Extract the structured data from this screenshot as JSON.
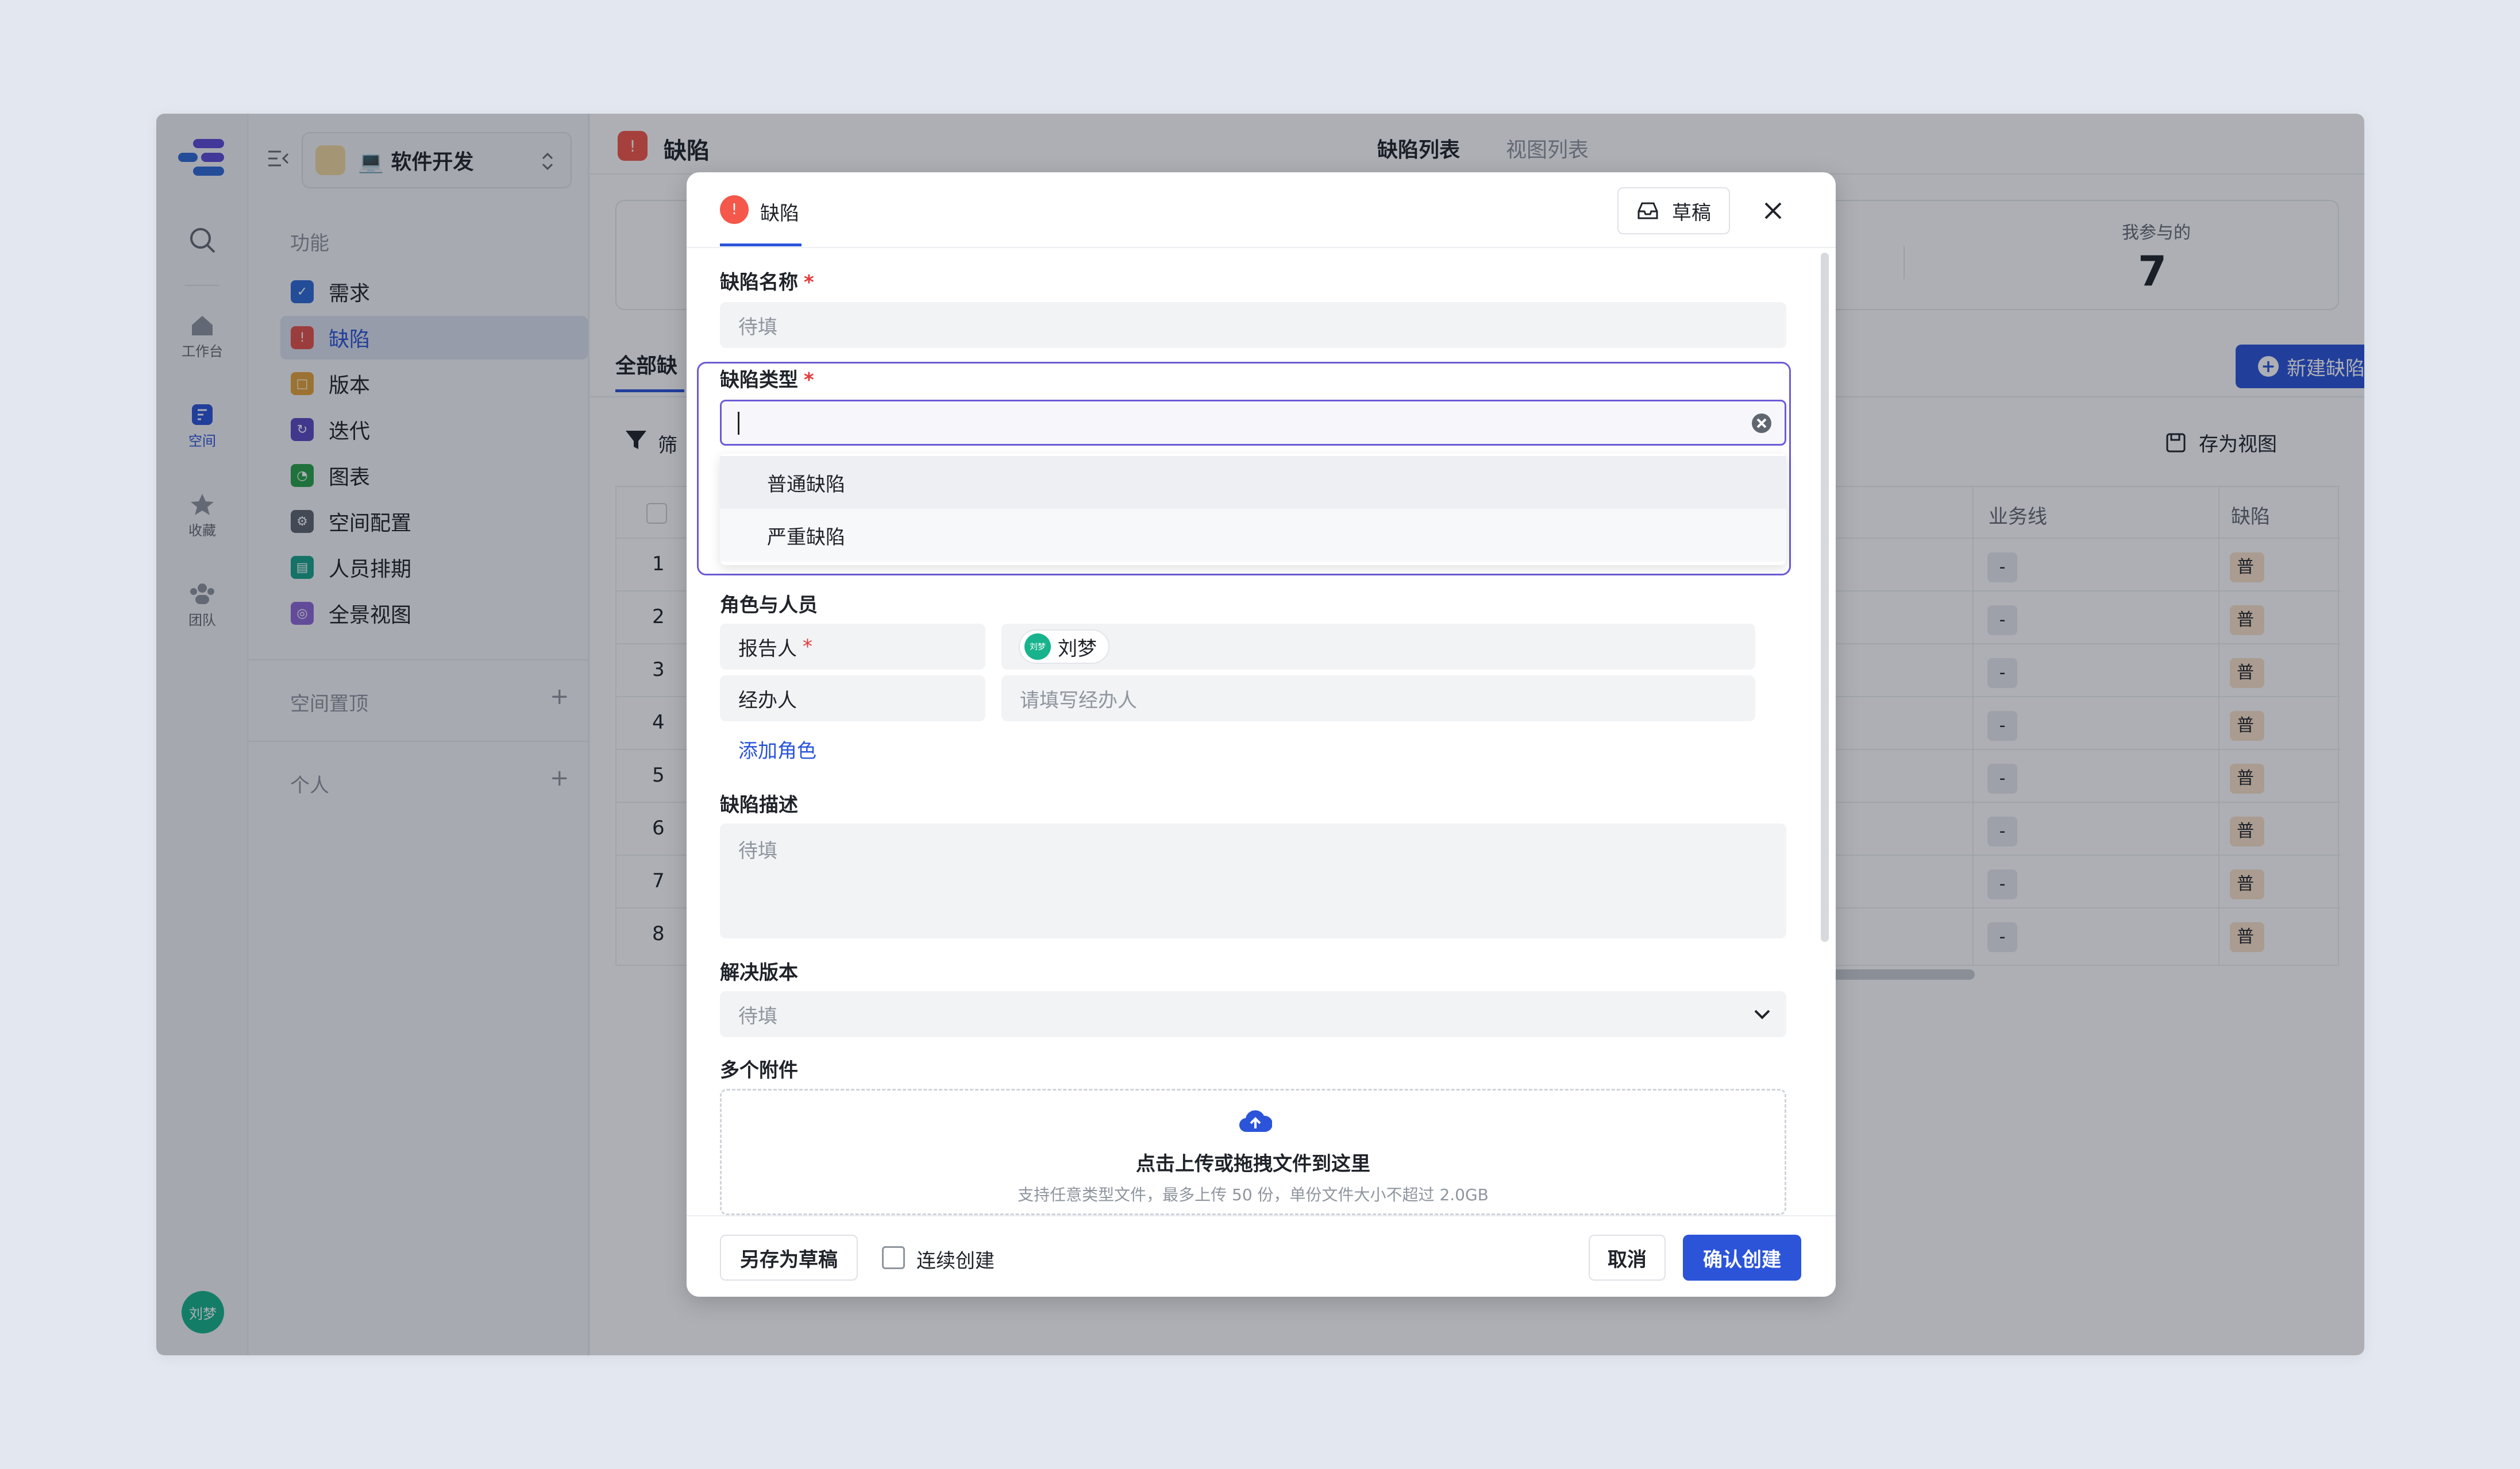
{
  "rail": {
    "workbench": "工作台",
    "space": "空间",
    "favorites": "收藏",
    "team": "团队",
    "avatar": "刘梦"
  },
  "sidebar": {
    "space_name": "💻 软件开发",
    "section_features": "功能",
    "items": [
      {
        "label": "需求",
        "color": "#2f6bd6"
      },
      {
        "label": "缺陷",
        "color": "#e5534b"
      },
      {
        "label": "版本",
        "color": "#e6a33a"
      },
      {
        "label": "迭代",
        "color": "#5b4bc4"
      },
      {
        "label": "图表",
        "color": "#2aa34a"
      },
      {
        "label": "空间配置",
        "color": "#5f6670"
      },
      {
        "label": "人员排期",
        "color": "#17a589"
      },
      {
        "label": "全景视图",
        "color": "#8e6ad8"
      }
    ],
    "pinned": "空间置顶",
    "personal": "个人"
  },
  "main": {
    "title": "缺陷",
    "tabs": [
      "缺陷列表",
      "视图列表"
    ],
    "stat_label": "我参与的",
    "stat_value": "7",
    "view_tab": "全部缺",
    "new_button": "新建缺陷",
    "filter": "筛",
    "save_view": "存为视图",
    "columns": [
      "业务线",
      "缺陷"
    ],
    "rows": [
      {
        "n": "1",
        "biz": "-",
        "type": "普"
      },
      {
        "n": "2",
        "biz": "-",
        "type": "普"
      },
      {
        "n": "3",
        "biz": "-",
        "type": "普"
      },
      {
        "n": "4",
        "biz": "-",
        "type": "普"
      },
      {
        "n": "5",
        "biz": "-",
        "type": "普"
      },
      {
        "n": "6",
        "biz": "-",
        "type": "普"
      },
      {
        "n": "7",
        "biz": "-",
        "type": "普"
      },
      {
        "n": "8",
        "biz": "-",
        "type": "普"
      }
    ]
  },
  "modal": {
    "tab": "缺陷",
    "draft": "草稿",
    "name_label": "缺陷名称",
    "name_placeholder": "待填",
    "type_label": "缺陷类型",
    "type_options": [
      "普通缺陷",
      "严重缺陷"
    ],
    "roles_label": "角色与人员",
    "reporter_label": "报告人",
    "reporter_value": "刘梦",
    "reporter_avatar": "刘梦",
    "handler_label": "经办人",
    "handler_placeholder": "请填写经办人",
    "add_role": "添加角色",
    "desc_label": "缺陷描述",
    "desc_placeholder": "待填",
    "version_label": "解决版本",
    "version_placeholder": "待填",
    "attach_label": "多个附件",
    "upload_title": "点击上传或拖拽文件到这里",
    "upload_hint": "支持任意类型文件，最多上传 50 份，单份文件大小不超过 2.0GB",
    "save_draft": "另存为草稿",
    "continuous": "连续创建",
    "cancel": "取消",
    "confirm": "确认创建"
  },
  "colors": {
    "accent": "#2b54d9",
    "danger": "#f5574a",
    "focus": "#6b5bd6"
  }
}
